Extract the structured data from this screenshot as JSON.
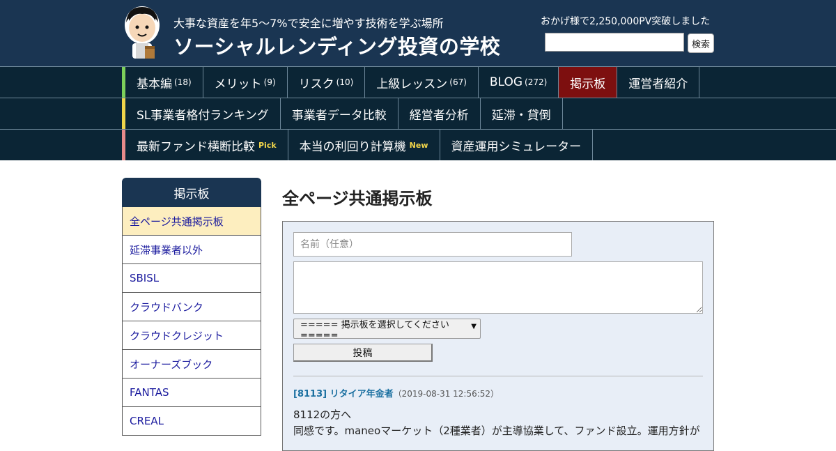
{
  "header": {
    "tagline": "大事な資産を年5～7%で安全に増やす技術を学ぶ場所",
    "site_title": "ソーシャルレンディング投資の学校",
    "pv_text": "おかげ様で2,250,000PV突破しました",
    "search_button": "検索"
  },
  "nav": {
    "rows": [
      {
        "accent": "#7ccf5a",
        "items": [
          {
            "label": "基本編",
            "count": "(18)"
          },
          {
            "label": "メリット",
            "count": "(9)"
          },
          {
            "label": "リスク",
            "count": "(10)"
          },
          {
            "label": "上級レッスン",
            "count": "(67)"
          },
          {
            "label": "BLOG",
            "count": "(272)"
          },
          {
            "label": "掲示板",
            "count": ""
          },
          {
            "label": "運営者紹介",
            "count": ""
          }
        ]
      },
      {
        "accent": "#f0d54a",
        "items": [
          {
            "label": "SL事業者格付ランキング"
          },
          {
            "label": "事業者データ比較"
          },
          {
            "label": "経営者分析"
          },
          {
            "label": "延滞・貸倒"
          }
        ]
      },
      {
        "accent": "#e88a8a",
        "items": [
          {
            "label": "最新ファンド横断比較",
            "tag": "Pick"
          },
          {
            "label": "本当の利回り計算機",
            "tag": "New"
          },
          {
            "label": "資産運用シミュレーター"
          }
        ]
      }
    ],
    "active_color": "#7d0f0f"
  },
  "sidebar": {
    "title": "掲示板",
    "items": [
      "全ページ共通掲示板",
      "延滞事業者以外",
      "SBISL",
      "クラウドバンク",
      "クラウドクレジット",
      "オーナーズブック",
      "FANTAS",
      "CREAL"
    ]
  },
  "main": {
    "title": "全ページ共通掲示板",
    "form": {
      "name_placeholder": "名前（任意）",
      "select_label": "===== 掲示板を選択してください =====",
      "post_button": "投稿"
    },
    "post": {
      "id_author": "[8113] リタイア年金者",
      "date": "（2019-08-31 12:56:52）",
      "line1": "8112の方へ",
      "line2": "同感です。maneoマーケット（2種業者）が主導協業して、ファンド設立。運用方針が"
    }
  },
  "colors": {
    "header_bg": "#1a3552",
    "nav_bg": "#0b2535",
    "sidebar_selected": "#fdeebf",
    "link": "#1a1a9e"
  }
}
